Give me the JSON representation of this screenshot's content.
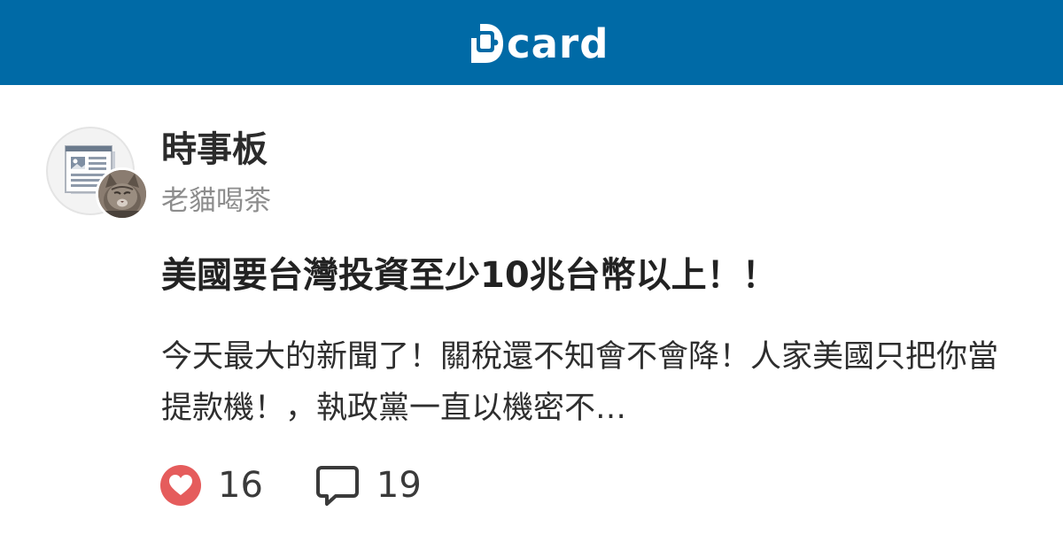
{
  "header": {
    "logo_text": "card",
    "brand_color": "#006aa6"
  },
  "forum": {
    "name": "時事板",
    "avatar_icon": "newspaper-icon"
  },
  "author": {
    "name": "老貓喝茶",
    "avatar_icon": "cat-avatar"
  },
  "post": {
    "title": "美國要台灣投資至少10兆台幣以上！！",
    "excerpt": "今天最大的新聞了！關稅還不知會不會降！人家美國只把你當提款機！，執政黨一直以機密不…"
  },
  "stats": {
    "likes": "16",
    "likes_icon": "heart-icon",
    "like_color": "#e55c5c",
    "comments": "19",
    "comments_icon": "comment-bubble-icon"
  }
}
